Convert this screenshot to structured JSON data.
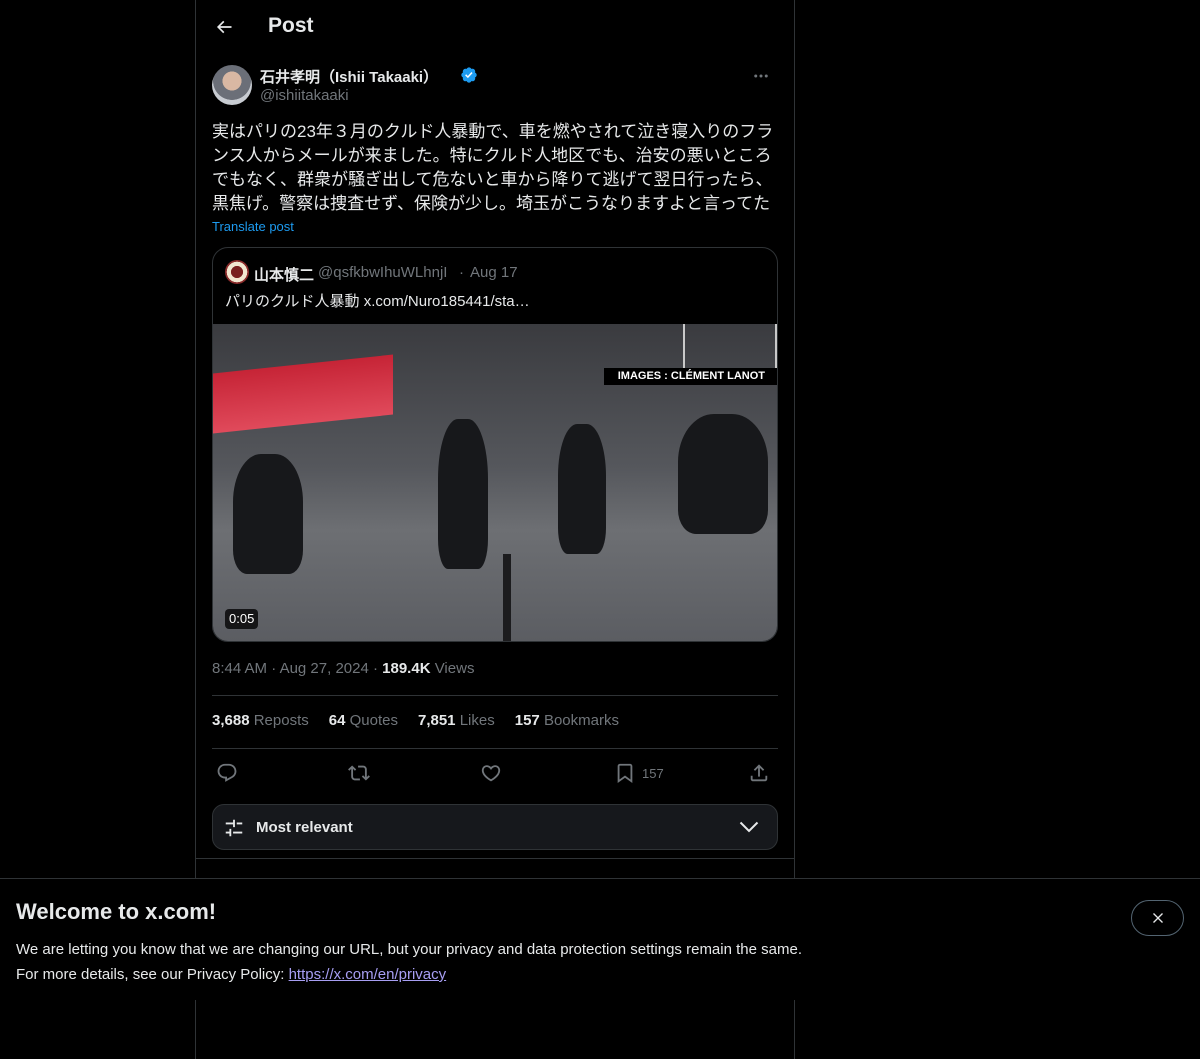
{
  "header": {
    "title": "Post"
  },
  "author": {
    "display_name": "石井孝明（Ishii Takaaki）",
    "handle": "@ishiitakaaki"
  },
  "post": {
    "text": "実はパリの23年３月のクルド人暴動で、車を燃やされて泣き寝入りのフランス人からメールが来ました。特にクルド人地区でも、治安の悪いところでもなく、群衆が騒ぎ出して危ないと車から降りて逃げて翌日行ったら、黒焦げ。警察は捜査せず、保険が少し。埼玉がこうなりますよと言ってた",
    "translate_label": "Translate post",
    "time": "8:44 AM",
    "date": "Aug 27, 2024",
    "views_count": "189.4K",
    "views_label": "Views"
  },
  "quote": {
    "display_name": "山本慎二",
    "handle": "@qsfkbwIhuWLhnjI",
    "date": "Aug 17",
    "text": "パリのクルド人暴動  x.com/Nuro185441/sta…",
    "media_caption": "IMAGES : CLÉMENT LANOT",
    "duration": "0:05"
  },
  "stats": [
    {
      "count": "3,688",
      "label": "Reposts"
    },
    {
      "count": "64",
      "label": "Quotes"
    },
    {
      "count": "7,851",
      "label": "Likes"
    },
    {
      "count": "157",
      "label": "Bookmarks"
    }
  ],
  "actions": {
    "reply_icon": "reply-icon",
    "repost_icon": "repost-icon",
    "like_icon": "heart-icon",
    "bookmark_icon": "bookmark-icon",
    "bookmark_count": "157",
    "share_icon": "share-icon"
  },
  "sort": {
    "label": "Most relevant"
  },
  "banner": {
    "title": "Welcome to x.com!",
    "line1": "We are letting you know that we are changing our URL, but your privacy and data protection settings remain the same.",
    "line2_prefix": "For more details, see our Privacy Policy: ",
    "link": "https://x.com/en/privacy"
  },
  "colors": {
    "background": "#000000",
    "accent": "#1d9bf0",
    "muted": "#71767b",
    "border": "#2f3336",
    "link_banner": "#a79ef2"
  }
}
